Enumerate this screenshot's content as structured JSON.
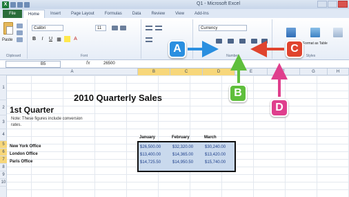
{
  "window": {
    "title": "Q1 - Microsoft Excel"
  },
  "file_tab": "File",
  "tabs": [
    "Home",
    "Insert",
    "Page Layout",
    "Formulas",
    "Data",
    "Review",
    "View",
    "Add-Ins"
  ],
  "ribbon": {
    "paste_label": "Paste",
    "font_name": "Calibri",
    "font_size": "11",
    "number_format": "Currency",
    "groups": {
      "clipboard": "Clipboard",
      "font": "Font",
      "number": "Number",
      "styles": "Styles"
    },
    "styles_label": "Format as Table"
  },
  "formula_bar": {
    "name_box": "B5",
    "fx": "fx",
    "value": "26500"
  },
  "columns": [
    "A",
    "B",
    "C",
    "D",
    "E",
    "F",
    "G",
    "H"
  ],
  "rows": [
    "1",
    "2",
    "3",
    "4",
    "5",
    "6",
    "7",
    "8",
    "9",
    "10"
  ],
  "sheet": {
    "title": "2010 Quarterly Sales",
    "subtitle": "1st Quarter",
    "note_line1": "Note: These figures include conversion",
    "note_line2": "rates.",
    "headers": [
      "January",
      "February",
      "March"
    ],
    "offices": [
      {
        "name": "New York Office",
        "values": [
          "$26,500.00",
          "$32,320.00",
          "$30,240.00"
        ]
      },
      {
        "name": "London Office",
        "values": [
          "$13,400.00",
          "$14,365.00",
          "$13,420.00"
        ]
      },
      {
        "name": "Paris Office",
        "values": [
          "$14,725.50",
          "$14,950.50",
          "$15,740.00"
        ]
      }
    ]
  },
  "callouts": {
    "a": "A",
    "b": "B",
    "c": "C",
    "d": "D"
  },
  "colors": {
    "callout_a": "#2a8fe0",
    "callout_b": "#5fbf3c",
    "callout_c": "#e0442e",
    "callout_d": "#df3f8d"
  }
}
